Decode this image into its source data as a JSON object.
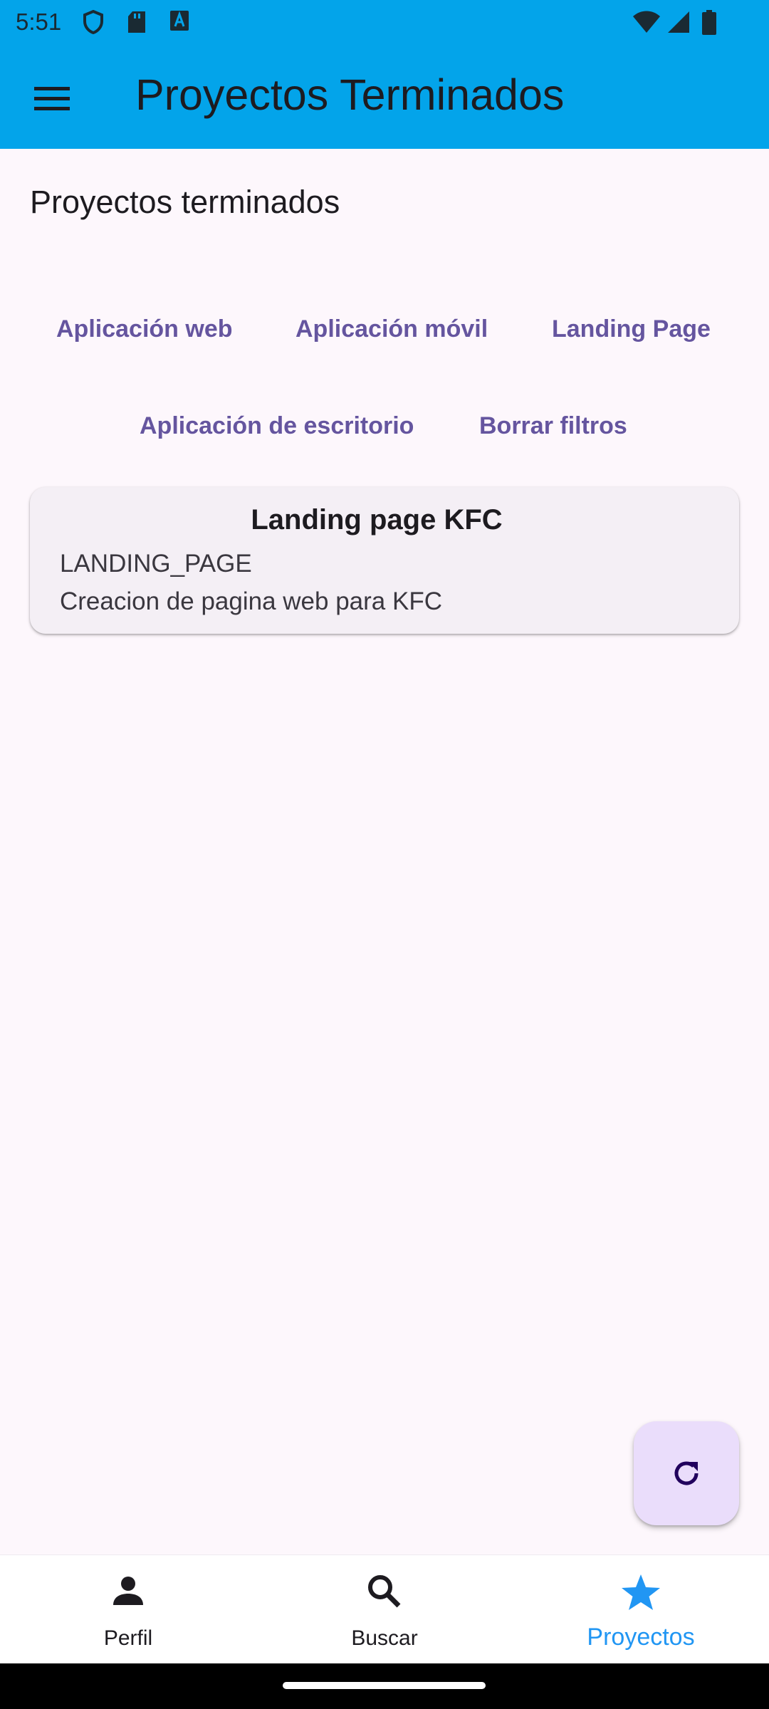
{
  "status_bar": {
    "time": "5:51"
  },
  "app_bar": {
    "title": "Proyectos Terminados",
    "menu_icon": "menu-icon"
  },
  "section": {
    "title": "Proyectos terminados"
  },
  "filters": {
    "web": "Aplicación web",
    "mobile": "Aplicación móvil",
    "landing": "Landing Page",
    "desktop": "Aplicación de escritorio",
    "clear": "Borrar filtros"
  },
  "projects": [
    {
      "title": "Landing page KFC",
      "type": "LANDING_PAGE",
      "description": "Creacion de pagina web para KFC"
    }
  ],
  "fab": {
    "icon": "refresh-icon"
  },
  "bottom_nav": {
    "items": [
      {
        "label": "Perfil",
        "icon": "person-icon"
      },
      {
        "label": "Buscar",
        "icon": "search-icon"
      },
      {
        "label": "Proyectos",
        "icon": "star-icon"
      }
    ],
    "active_color": "#2196f3"
  },
  "colors": {
    "app_bar": "#03a4ea",
    "background": "#fdf7fc",
    "filter_text": "#65559f",
    "fab": "#eaddfb"
  }
}
